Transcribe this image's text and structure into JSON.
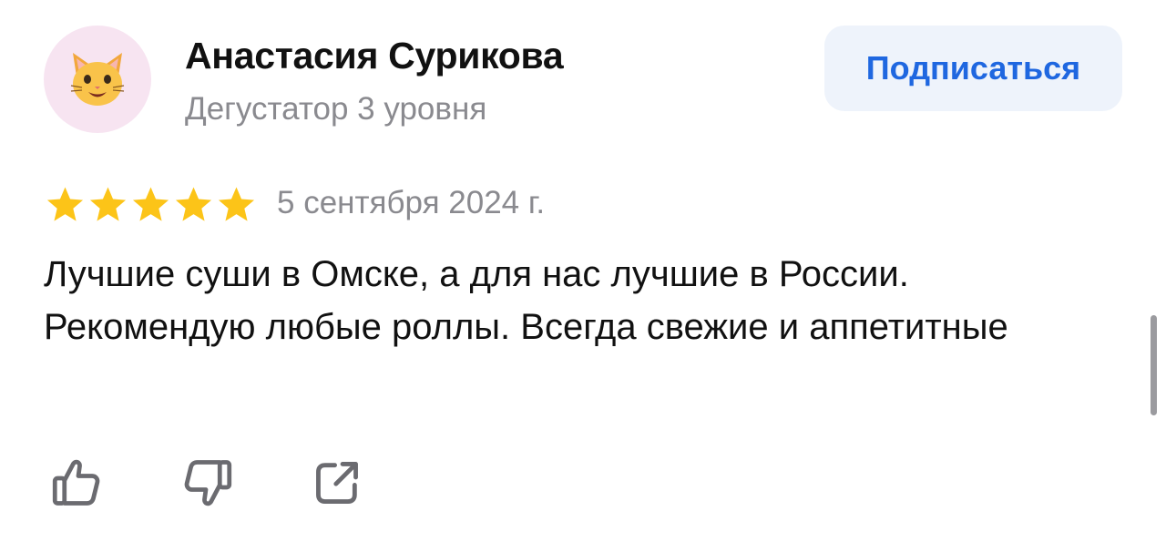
{
  "author": {
    "name": "Анастасия Сурикова",
    "level": "Дегустатор 3 уровня",
    "avatar_icon": "cat-face-emoji-icon"
  },
  "subscribe": {
    "label": "Подписаться",
    "color": "#1f67e0"
  },
  "review": {
    "rating": 5,
    "rating_max": 5,
    "star_color": "#fcc418",
    "date": "5 сентября 2024 г.",
    "text": "Лучшие суши в Омске, а для нас лучшие в России. Рекомендую любые роллы. Всегда свежие и аппетитные"
  },
  "actions": [
    {
      "name": "like",
      "icon": "thumbs-up-icon"
    },
    {
      "name": "dislike",
      "icon": "thumbs-down-icon"
    },
    {
      "name": "share",
      "icon": "share-icon"
    }
  ]
}
